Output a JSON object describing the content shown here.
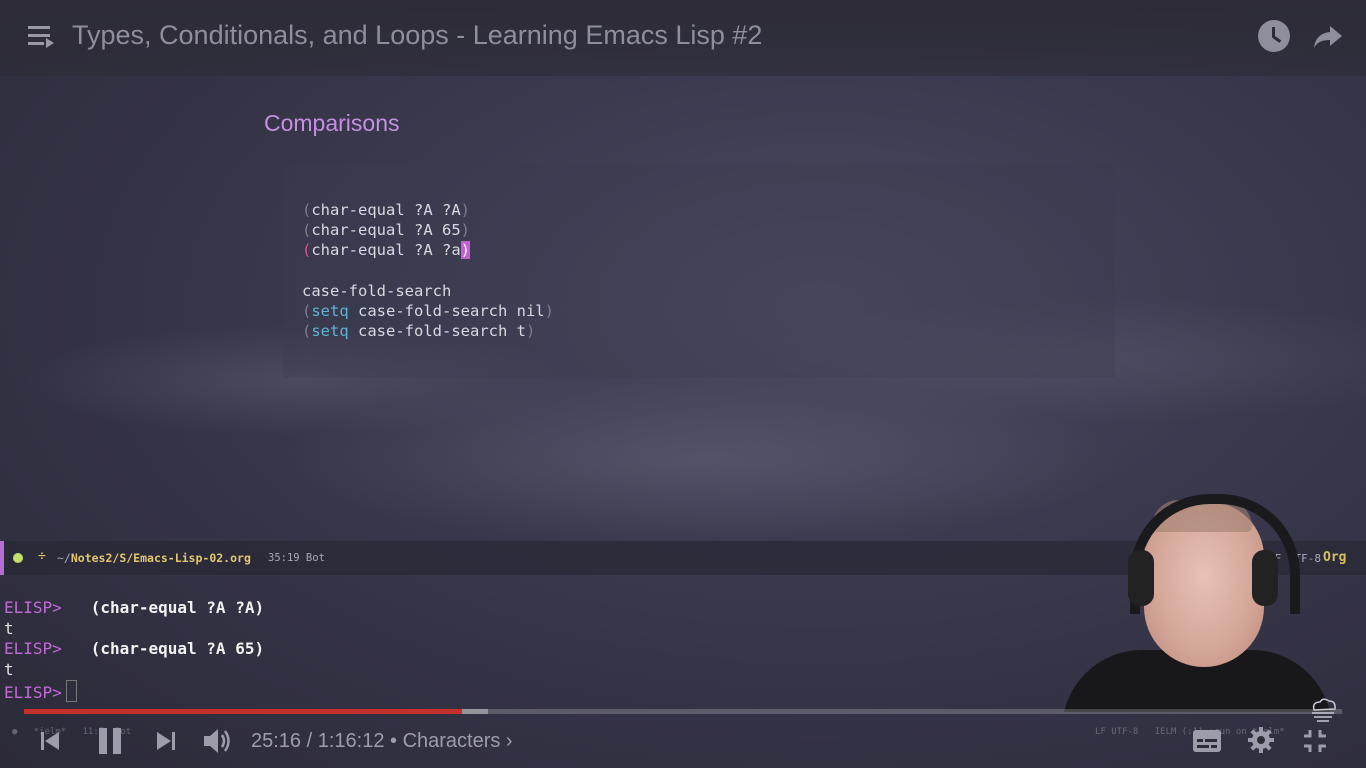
{
  "header": {
    "title": "Types, Conditionals, and Loops - Learning Emacs Lisp #2"
  },
  "slide": {
    "heading": "Comparisons",
    "code": {
      "l1_open": "(",
      "l1_body": "char-equal ?A ?A",
      "l1_close": ")",
      "l2_open": "(",
      "l2_body": "char-equal ?A 65",
      "l2_close": ")",
      "l3_open": "(",
      "l3_body": "char-equal ?A ?a",
      "l3_close": ")",
      "l4": "case-fold-search",
      "l5_open": "(",
      "l5_kw": "setq",
      "l5_body": " case-fold-search nil",
      "l5_close": ")",
      "l6_open": "(",
      "l6_kw": "setq",
      "l6_body": " case-fold-search t",
      "l6_close": ")"
    }
  },
  "modeline": {
    "modified": "÷",
    "path_prefix": "~/",
    "path_bold": "Notes2/S/Emacs-Lisp-02.org",
    "position": "35:19 Bot",
    "encoding": "LF UTF-8",
    "mode": "Org"
  },
  "repl": {
    "prompt": "ELISP>",
    "input1": "(char-equal ?A ?A)",
    "result1": "t",
    "input2": "(char-equal ?A 65)",
    "result2": "t"
  },
  "player": {
    "time": "25:16 / 1:16:12 • Characters ›",
    "progress_fraction": 0.332,
    "faint_left": "●   *ielm*   11:7  Bot",
    "faint_right": "LF UTF-8   IELM (:1) :run on *ielm*"
  },
  "colors": {
    "progress": "#c4302b",
    "accent": "#c58fe2"
  },
  "icons": {
    "menu": "playlist-menu-icon",
    "clock": "watch-later-icon",
    "share": "share-icon",
    "prev": "skip-previous-icon",
    "pause": "pause-icon",
    "next": "skip-next-icon",
    "volume": "volume-icon",
    "subtitles": "subtitles-icon",
    "settings": "gear-icon",
    "fullscreen": "exit-fullscreen-icon"
  }
}
